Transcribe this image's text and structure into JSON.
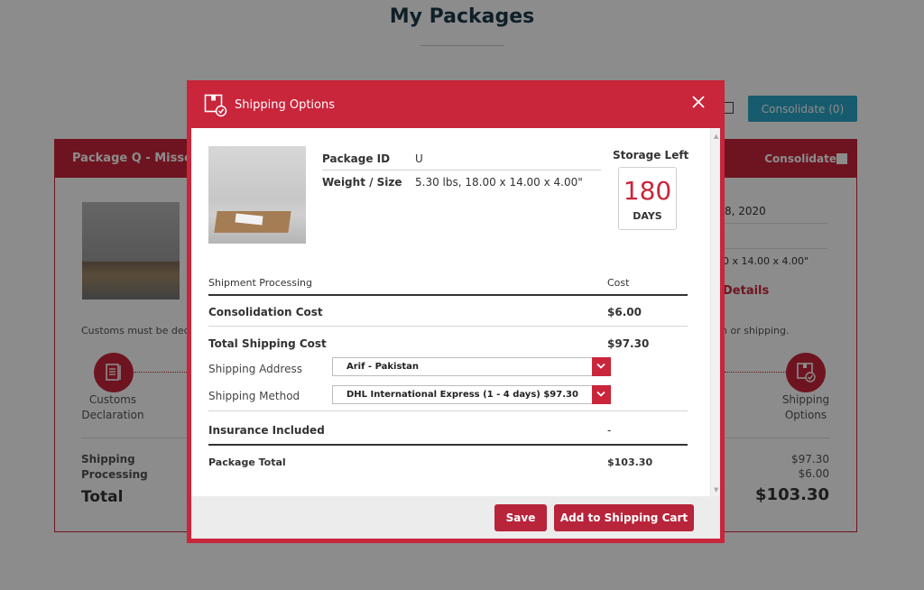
{
  "page": {
    "title": "My Packages",
    "consolidate_button": "Consolidate (0)"
  },
  "package_card": {
    "name": "Package Q - Missey",
    "consolidate_label": "Consolidate",
    "customs_note_left": "Customs must be dec",
    "customs_note_right": "n or shipping.",
    "date_fragment": "8, 2020",
    "dimensions_fragment": "0 x 14.00 x 4.00\"",
    "details_fragment": "Details",
    "steps": {
      "customs_label": "Customs Declaration",
      "shipping_label": "Shipping Options"
    },
    "summary": {
      "shipping_label": "Shipping",
      "processing_label": "Processing",
      "total_label": "Total",
      "shipping_value": "$97.30",
      "processing_value": "$6.00",
      "total_value": "$103.30"
    }
  },
  "modal": {
    "title": "Shipping Options",
    "close_icon": "close-icon",
    "package_id_label": "Package ID",
    "package_id_value": "U",
    "weight_label": "Weight / Size",
    "weight_value": "5.30 lbs, 18.00 x 14.00 x 4.00\"",
    "storage_label": "Storage Left",
    "storage_days": "180",
    "storage_unit": "DAYS",
    "table": {
      "col_processing": "Shipment Processing",
      "col_cost": "Cost",
      "consolidation_label": "Consolidation Cost",
      "consolidation_value": "$6.00",
      "total_shipping_label": "Total Shipping Cost",
      "total_shipping_value": "$97.30",
      "insurance_label": "Insurance Included",
      "insurance_value": "-",
      "package_total_label": "Package Total",
      "package_total_value": "$103.30"
    },
    "shipping_address_label": "Shipping Address",
    "shipping_address_value": "Arif - Pakistan",
    "shipping_method_label": "Shipping Method",
    "shipping_method_value": "DHL International Express (1 - 4 days) $97.30",
    "save_button": "Save",
    "add_to_cart_button": "Add to Shipping Cart"
  },
  "colors": {
    "brand_red": "#c9253b",
    "accent_blue": "#2aa6c8"
  }
}
